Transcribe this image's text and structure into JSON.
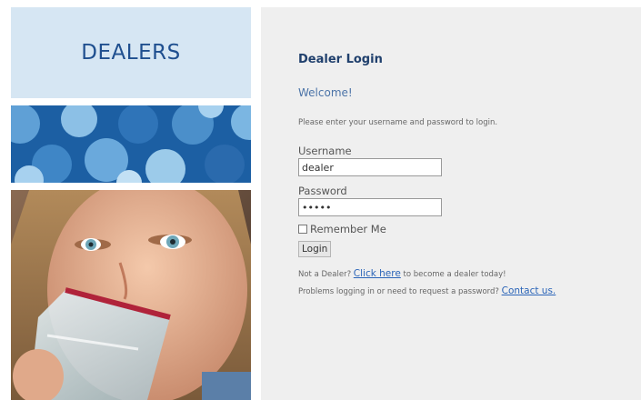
{
  "sidebar": {
    "title": "DEALERS"
  },
  "login": {
    "heading": "Dealer Login",
    "welcome": "Welcome!",
    "instructions": "Please enter your username and password to login.",
    "username_label": "Username",
    "username_value": "dealer",
    "password_label": "Password",
    "password_value": "•••••",
    "remember_label": "Remember Me",
    "login_button": "Login",
    "not_dealer_text": "Not a Dealer?",
    "click_here_link": "Click here",
    "become_dealer_text": " to become a dealer today!",
    "problems_text": "Problems logging in or need to request a password?",
    "contact_link": "Contact us."
  },
  "colors": {
    "brand_blue": "#1f4f8f",
    "heading_navy": "#20406d",
    "link_blue": "#2a64b8",
    "panel_bg": "#efefef",
    "dealers_box_bg": "#d6e6f3"
  }
}
